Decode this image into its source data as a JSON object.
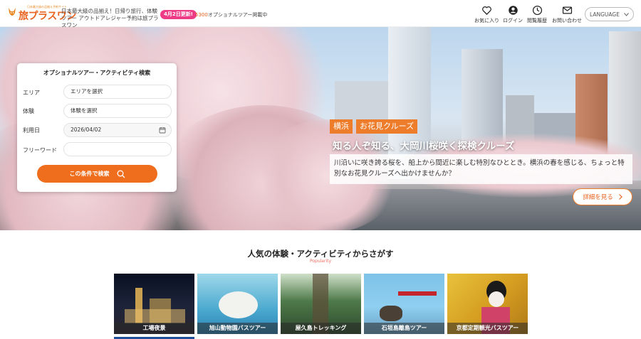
{
  "header": {
    "logo_small": "日本最大級の品揃え予約サイト",
    "logo_text": "旅プラスワン",
    "tagline": "日本最大級の品揃え！日帰り旅行、体験ツアー アウトドアレジャー予約は旅プラスワン",
    "update_badge": "4月2日更新!",
    "tour_count_num": "5300",
    "tour_count_text": "オプショナルツアー掲載中",
    "nav": {
      "favorites": "お気に入り",
      "login": "ログイン",
      "history": "閲覧履歴",
      "contact": "お問い合わせ"
    },
    "language": "LANGUAGE"
  },
  "search": {
    "title": "オプショナルツアー・アクティビティ検索",
    "area_label": "エリア",
    "area_value": "エリアを選択",
    "experience_label": "体験",
    "experience_value": "体験を選択",
    "date_label": "利用日",
    "date_value": "2026/04/02",
    "freeword_label": "フリーワード",
    "freeword_value": "",
    "submit_label": "この条件で検索"
  },
  "hero": {
    "tag1": "横浜",
    "tag2": "お花見クルーズ",
    "title": "知る人ぞ知る、大岡川桜咲く探検クルーズ",
    "description": "川沿いに咲き誇る桜を、船上から間近に楽しむ特別なひととき。横浜の春を感じる、ちょっと特別なお花見クルーズへ出かけませんか？",
    "more_label": "詳細を見る"
  },
  "popular": {
    "title": "人気の体験・アクティビティからさがす",
    "subtitle": "Popularity",
    "cards": [
      {
        "label": "工場夜景"
      },
      {
        "label": "旭山動物園バスツアー"
      },
      {
        "label": "屋久島トレッキング"
      },
      {
        "label": "石垣島離島ツアー"
      },
      {
        "label": "京都定期観光バスツアー"
      }
    ]
  },
  "colors": {
    "accent": "#ef6e1e",
    "badge": "#ee3b86",
    "tag": "#ed7d2b"
  }
}
